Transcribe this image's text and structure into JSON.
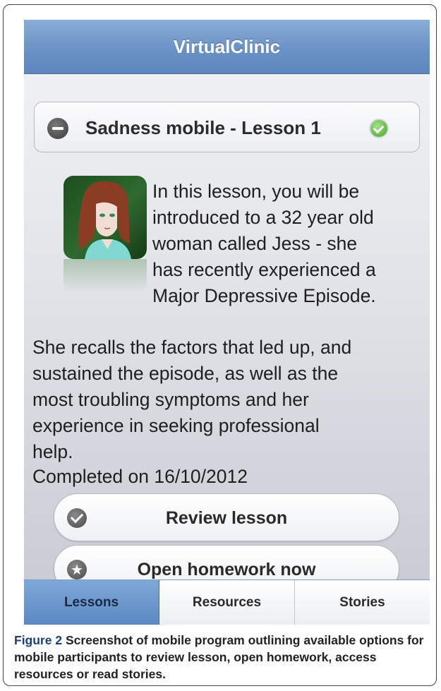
{
  "app": {
    "title": "VirtualClinic"
  },
  "lesson": {
    "title": "Sadness mobile - Lesson 1",
    "description_lines_floated": [
      "In this lesson, you will be",
      "introduced to a 32 year old",
      "woman called Jess - she",
      "has recently experienced a",
      "Major Depressive Episode."
    ],
    "description_lines_full": [
      "She recalls the factors that led up, and",
      "sustained the episode, as well as the",
      "most troubling symptoms and her",
      "experience in seeking professional",
      "help."
    ],
    "completed_text": "Completed on 16/10/2012",
    "icons": {
      "collapse": "minus-icon",
      "status": "check-icon",
      "avatar": "jess-avatar"
    }
  },
  "buttons": {
    "review": {
      "label": "Review lesson",
      "icon": "check-icon"
    },
    "homework": {
      "label": "Open homework now",
      "icon": "star-icon"
    }
  },
  "tabs": [
    {
      "label": "Lessons",
      "active": true
    },
    {
      "label": "Resources",
      "active": false
    },
    {
      "label": "Stories",
      "active": false
    }
  ],
  "caption": {
    "label": "Figure 2",
    "text": " Screenshot of mobile program outlining available options for mobile participants to review lesson, open homework, access resources or read stories."
  },
  "colors": {
    "header": "#6b92c6",
    "tab_active": "#5b88c2",
    "status_green": "#5db33c",
    "caption_label": "#1d3f78"
  }
}
